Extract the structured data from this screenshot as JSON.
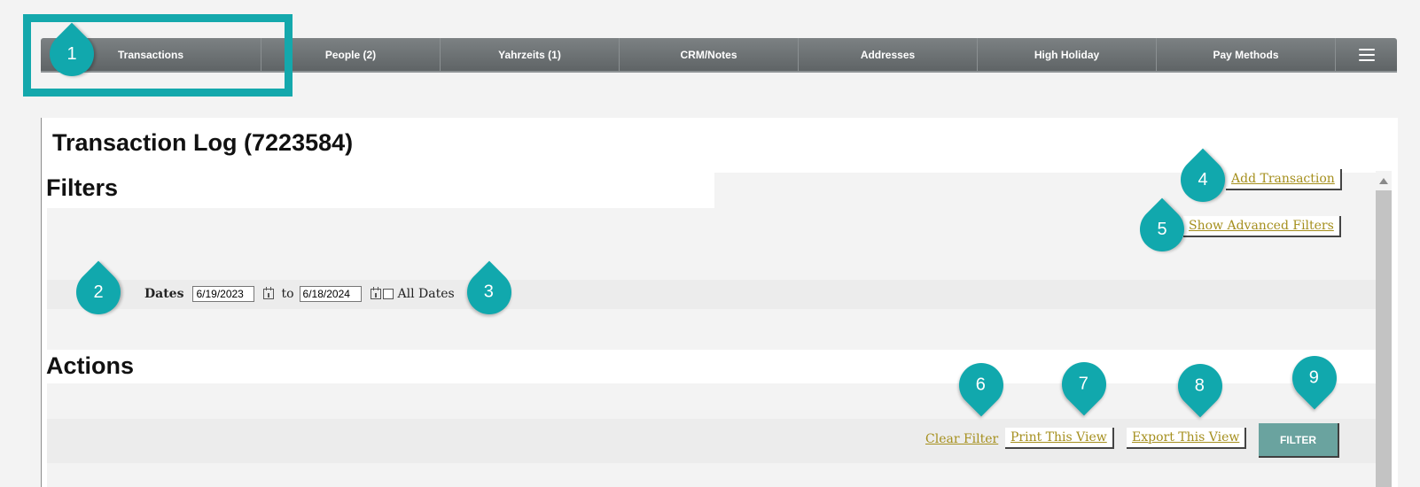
{
  "nav": {
    "tabs": [
      {
        "label": "Transactions"
      },
      {
        "label": "People (2)"
      },
      {
        "label": "Yahrzeits (1)"
      },
      {
        "label": "CRM/Notes"
      },
      {
        "label": "Addresses"
      },
      {
        "label": "High Holiday"
      },
      {
        "label": "Pay Methods"
      }
    ],
    "menu_icon": "hamburger-icon"
  },
  "page": {
    "title": "Transaction Log (7223584)"
  },
  "filters": {
    "heading": "Filters",
    "add_transaction": "Add Transaction",
    "show_advanced": "Show Advanced Filters",
    "dates_label": "Dates",
    "date_from": "6/19/2023",
    "to_label": "to",
    "date_to": "6/18/2024",
    "all_dates_label": "All Dates"
  },
  "actions": {
    "heading": "Actions",
    "clear_filter": "Clear Filter",
    "print_view": "Print This View",
    "export_view": "Export This View",
    "filter_button": "FILTER"
  },
  "callouts": [
    "1",
    "2",
    "3",
    "4",
    "5",
    "6",
    "7",
    "8",
    "9"
  ],
  "colors": {
    "accent": "#11a8ad",
    "link": "#a58f1d",
    "filter_button": "#6aa39f",
    "tabbar": "#6d7274"
  }
}
